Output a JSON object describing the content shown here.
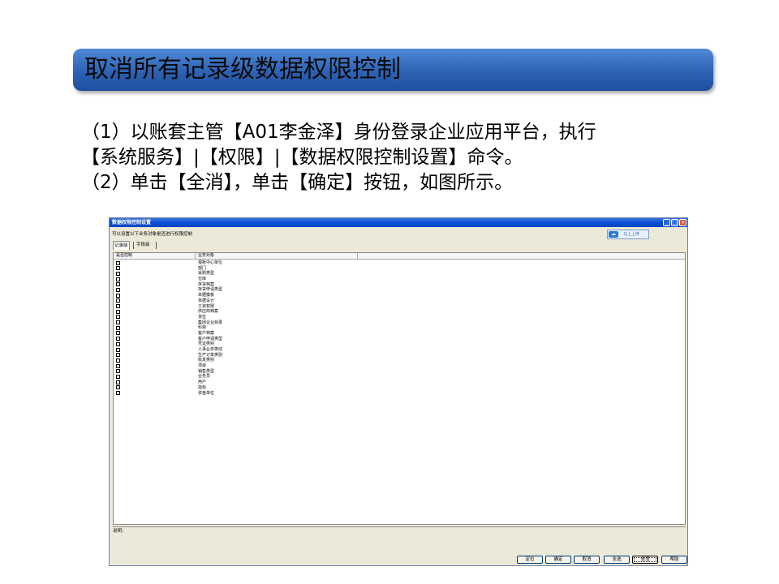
{
  "slide": {
    "title": "取消所有记录级数据权限控制",
    "lines": [
      "（1）以账套主管【A01李金泽】身份登录企业应用平台，执行",
      "【系统服务】|【权限】|【数据权限控制设置】命令。",
      "（2）单击【全消】，单击【确定】按钮，如图所示。"
    ]
  },
  "window": {
    "title": "数据权限控制设置",
    "controls": {
      "minimize": "_",
      "maximize": "□",
      "close": "×"
    },
    "description": "可以设置以下业务对象是否进行权限控制",
    "upload_button": "马上上传",
    "tabs": [
      "记录级",
      "字段级"
    ],
    "columns": [
      "是否控制",
      "业务对象"
    ],
    "rows": [
      "报账中心单位",
      "部门",
      "采购类型",
      "仓库",
      "存货档案",
      "存货申请类型",
      "单据模板",
      "单据设计",
      "工资权限",
      "供应商档案",
      "货位",
      "集团企业目录",
      "科目",
      "客户档案",
      "客户申请类型",
      "凭证类别",
      "人事业务类动",
      "生产订单类别",
      "收发类别",
      "项目",
      "销售类型",
      "业务员",
      "用户",
      "指标",
      "资金单位"
    ],
    "note_label": "说明：",
    "buttons": [
      "定位",
      "确定",
      "取消",
      "全选",
      "全消",
      "帮助"
    ]
  },
  "colors": {
    "title_gradient_top": "#4f8ad6",
    "title_gradient_bottom": "#1f4f9d",
    "window_face": "#ece9d8",
    "window_title_blue": "#0a4fd2"
  }
}
